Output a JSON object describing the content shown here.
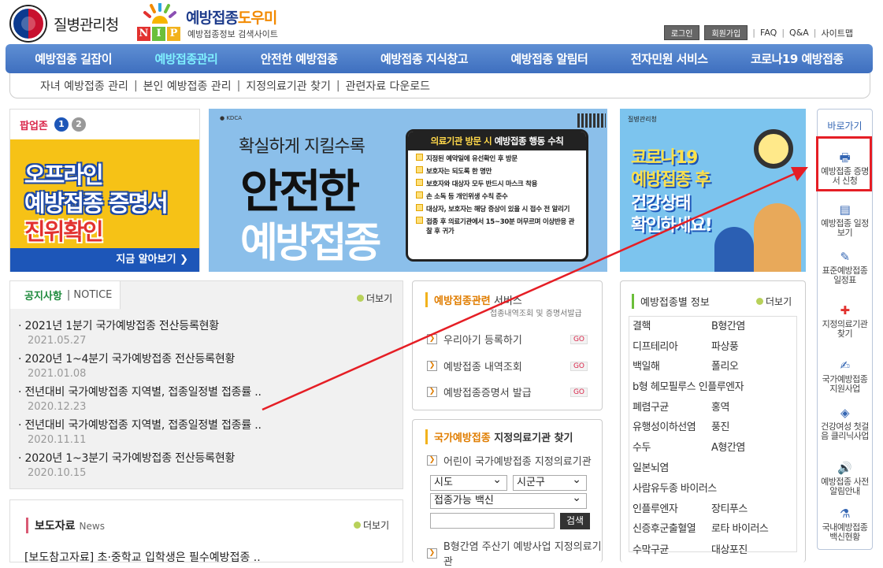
{
  "header": {
    "org_name": "질병관리청",
    "nip_letters": [
      "N",
      "I",
      "P"
    ],
    "site_title_a": "예방접종",
    "site_title_b": "도우미",
    "site_sub": "예방접종정보 검색사이트",
    "util": {
      "login": "로그인",
      "join": "회원가입",
      "faq": "FAQ",
      "qna": "Q&A",
      "sitemap": "사이트맵"
    }
  },
  "gnb": [
    "예방접종 길잡이",
    "예방접종관리",
    "안전한 예방접종",
    "예방접종 지식창고",
    "예방접종 알림터",
    "전자민원 서비스",
    "코로나19 예방접종"
  ],
  "subnav": [
    "자녀 예방접종 관리",
    "본인 예방접종 관리",
    "지정의료기관 찾기",
    "관련자료 다운로드"
  ],
  "popup": {
    "title": "팝업존",
    "nums": [
      "1",
      "2"
    ],
    "lines": [
      "오프라인",
      "예방접종 증명서",
      "진위확인"
    ],
    "more": "지금 알아보기 ❯"
  },
  "banner": {
    "line1": "확실하게 지킬수록",
    "line2": "안전한",
    "line3": "예방접종",
    "card_title_a": "의료기관 방문 시",
    "card_title_b": " 예방접종 행동 수칙",
    "rules": [
      "지정된 예약일에 유선확인 후 방문",
      "보호자는 되도록 한 명만",
      "보호자와 대상자 모두 반드시 마스크 착용",
      "손 소독 등 개인위생 수칙 준수",
      "대상자, 보호자는 해당 증상이 있을 시 접수 전 알리기",
      "접종 후 의료기관에서 15~30분 머무르며 이상반응 관찰 후 귀가"
    ]
  },
  "covid": {
    "org": "질병관리청",
    "lines": [
      "코로나19",
      "예방접종 후",
      "건강상태",
      "확인하세요!"
    ]
  },
  "quick": {
    "title": "바로가기",
    "items": [
      {
        "icon": "printer-icon",
        "glyph": "🖶",
        "label": "예방접종 증명서 신청"
      },
      {
        "icon": "calendar-icon",
        "glyph": "▤",
        "label": "예방접종 일정보기"
      },
      {
        "icon": "syringe-icon",
        "glyph": "✎",
        "label": "표준예방접종 일정표"
      },
      {
        "icon": "hospital-icon",
        "glyph": "✚",
        "label": "지정의료기관 찾기"
      },
      {
        "icon": "document-icon",
        "glyph": "✍",
        "label": "국가예방접종 지원사업"
      },
      {
        "icon": "box-icon",
        "glyph": "◈",
        "label": "건강여성 첫걸음 클리닉사업"
      },
      {
        "icon": "speaker-icon",
        "glyph": "🔊",
        "label": "예방접종 사전알림안내"
      },
      {
        "icon": "vial-icon",
        "glyph": "⚗",
        "label": "국내예방접종 백신현황"
      }
    ]
  },
  "notice": {
    "title": "공지사항",
    "title_en": "NOTICE",
    "more": "더보기",
    "items": [
      {
        "title": "· 2021년 1분기 국가예방접종 전산등록현황",
        "date": "2021.05.27"
      },
      {
        "title": "· 2020년 1~4분기 국가예방접종 전산등록현황",
        "date": "2021.01.08"
      },
      {
        "title": "· 전년대비 국가예방접종 지역별, 접종일정별 접종률 ..",
        "date": "2020.12.23"
      },
      {
        "title": "· 전년대비 국가예방접종 지역별, 접종일정별 접종률 ..",
        "date": "2020.11.11"
      },
      {
        "title": "· 2020년 1~3분기 국가예방접종 전산등록현황",
        "date": "2020.10.15"
      }
    ]
  },
  "press": {
    "title": "보도자료",
    "title_en": "News",
    "more": "더보기",
    "item": "[보도참고자료] 초·중학교 입학생은 필수예방접종 .."
  },
  "service": {
    "title_a": "예방접종관련",
    "title_b": " 서비스",
    "sub": "접종내역조회 및 증명서발급",
    "items": [
      "우리아기 등록하기",
      "예방접종 내역조회",
      "예방접종증명서 발급"
    ],
    "go": "GO"
  },
  "clinic": {
    "title_a": "국가예방접종",
    "title_b": " 지정의료기관 찾기",
    "item1": "어린이 국가예방접종 지정의료기관",
    "sido": "시도",
    "sigungu": "시군구",
    "vaccine": "접종가능 백신",
    "search": "검색",
    "item2": "B형간염 주산기 예방사업 지정의료기관"
  },
  "byvac": {
    "title": "예방접종별 정보",
    "more": "더보기",
    "items": [
      "결핵",
      "B형간염",
      "디프테리아",
      "파상풍",
      "백일해",
      "폴리오",
      "b형 헤모필루스 인플루엔자",
      "폐렴구균",
      "홍역",
      "유행성이하선염",
      "풍진",
      "수두",
      "A형간염",
      "일본뇌염",
      "사람유두종 바이러스",
      "인플루엔자",
      "장티푸스",
      "신증후군출혈열",
      "로타 바이러스",
      "수막구균",
      "대상포진"
    ]
  },
  "colors": {
    "gnb": "#4a7cc9",
    "accent": "#e51e25",
    "green": "#1e8a3c"
  }
}
